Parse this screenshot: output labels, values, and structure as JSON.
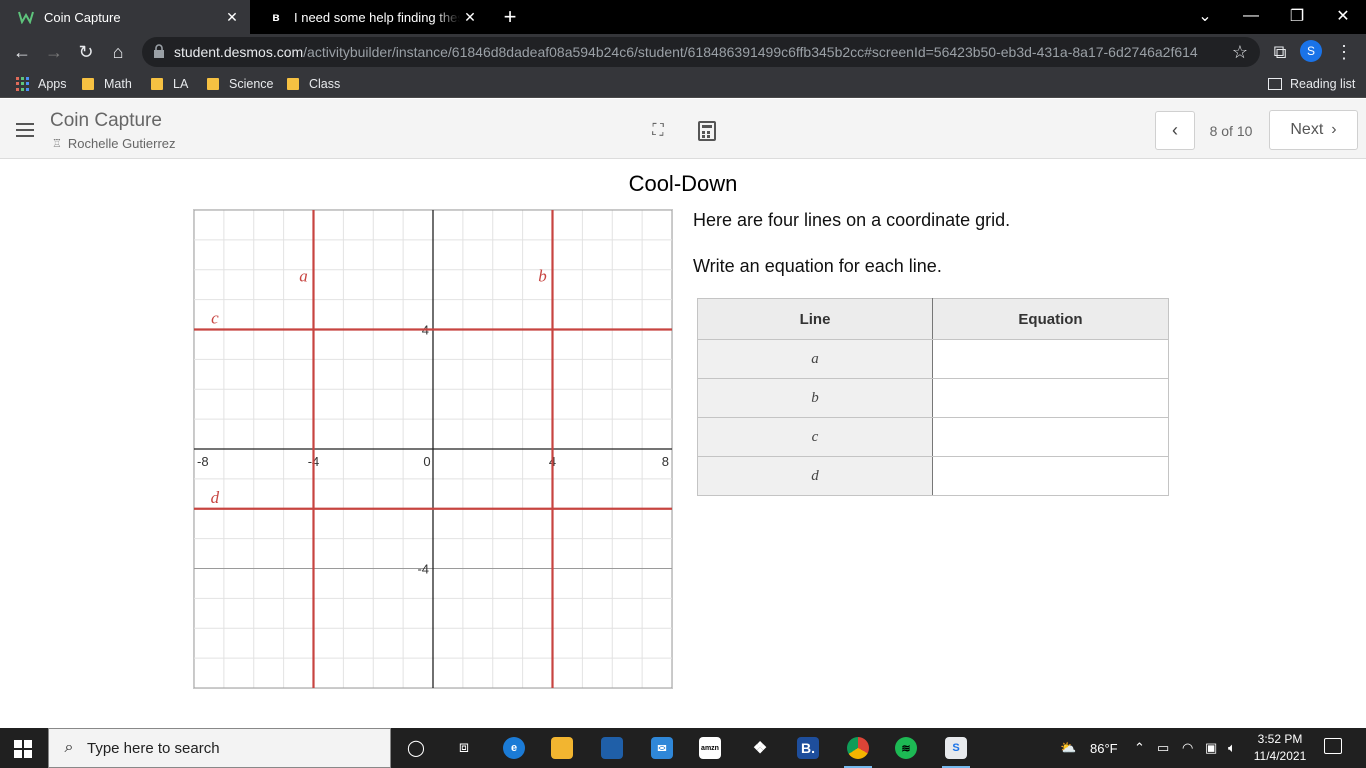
{
  "browser": {
    "tabs": [
      {
        "title": "Coin Capture",
        "favicon": "desmos-logo-icon",
        "active": true
      },
      {
        "title": "I need some help finding these equations",
        "favicon": "brainly-icon",
        "active": false
      }
    ],
    "url_host": "student.desmos.com",
    "url_path": "/activitybuilder/instance/61846d8dadeaf08a594b24c6/student/618486391499c6ffb345b2cc#screenId=56423b50-eb3d-431a-8a17-6d2746a2f614",
    "profile_initial": "S",
    "bookmarks": [
      {
        "label": "Apps",
        "icon": "apps-grid-icon"
      },
      {
        "label": "Math",
        "icon": "folder-icon"
      },
      {
        "label": "LA",
        "icon": "folder-icon"
      },
      {
        "label": "Science",
        "icon": "folder-icon"
      },
      {
        "label": "Class",
        "icon": "folder-icon"
      }
    ],
    "reading_list": "Reading list"
  },
  "header": {
    "activity_title": "Coin Capture",
    "teacher_name": "Rochelle Gutierrez",
    "page_count": "8 of 10",
    "next_label": "Next"
  },
  "screen": {
    "title": "Cool-Down",
    "prompt_line1": "Here are four lines on a coordinate grid.",
    "prompt_line2": "Write an equation for each line."
  },
  "graph": {
    "x_range": [
      -8,
      8
    ],
    "y_range": [
      -8,
      8
    ],
    "grid_step": 1,
    "x_tick_labels": [
      "-8",
      "-4",
      "0",
      "4",
      "8"
    ],
    "y_tick_labels": [
      "4",
      "-4"
    ],
    "line_color": "#c74440",
    "lines": [
      {
        "label": "a",
        "orientation": "vertical",
        "value": -4
      },
      {
        "label": "b",
        "orientation": "vertical",
        "value": 4
      },
      {
        "label": "c",
        "orientation": "horizontal",
        "value": 4
      },
      {
        "label": "d",
        "orientation": "horizontal",
        "value": -2
      }
    ]
  },
  "table": {
    "headers": [
      "Line",
      "Equation"
    ],
    "rows": [
      {
        "line": "a",
        "equation": ""
      },
      {
        "line": "b",
        "equation": ""
      },
      {
        "line": "c",
        "equation": ""
      },
      {
        "line": "d",
        "equation": ""
      }
    ]
  },
  "taskbar": {
    "search_placeholder": "Type here to search",
    "weather": "86°F",
    "time": "3:52 PM",
    "date": "11/4/2021"
  }
}
